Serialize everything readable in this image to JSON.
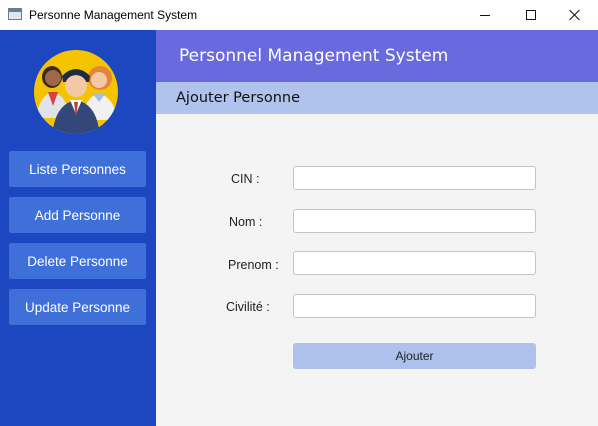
{
  "window": {
    "title": "Personne Management System",
    "icon": "app-window-icon",
    "controls": [
      "minimize-icon",
      "maximize-icon",
      "close-icon"
    ]
  },
  "sidebar": {
    "avatar_icon": "people-group-icon",
    "items": [
      {
        "label": "Liste Personnes"
      },
      {
        "label": "Add Personne"
      },
      {
        "label": "Delete Personne"
      },
      {
        "label": "Update Personne"
      }
    ]
  },
  "header": {
    "title": "Personnel Management System"
  },
  "subheader": {
    "title": "Ajouter Personne"
  },
  "form": {
    "fields": [
      {
        "label": "CIN :",
        "value": ""
      },
      {
        "label": "Nom :",
        "value": ""
      },
      {
        "label": "Prenom :",
        "value": ""
      },
      {
        "label": "Civilité :",
        "value": ""
      }
    ],
    "submit_label": "Ajouter"
  },
  "colors": {
    "sidebar": "#1d47c0",
    "sidebar_button": "#3f6fd8",
    "header": "#6a6adf",
    "subheader": "#b0c3ec",
    "submit_button": "#adc1ec"
  }
}
